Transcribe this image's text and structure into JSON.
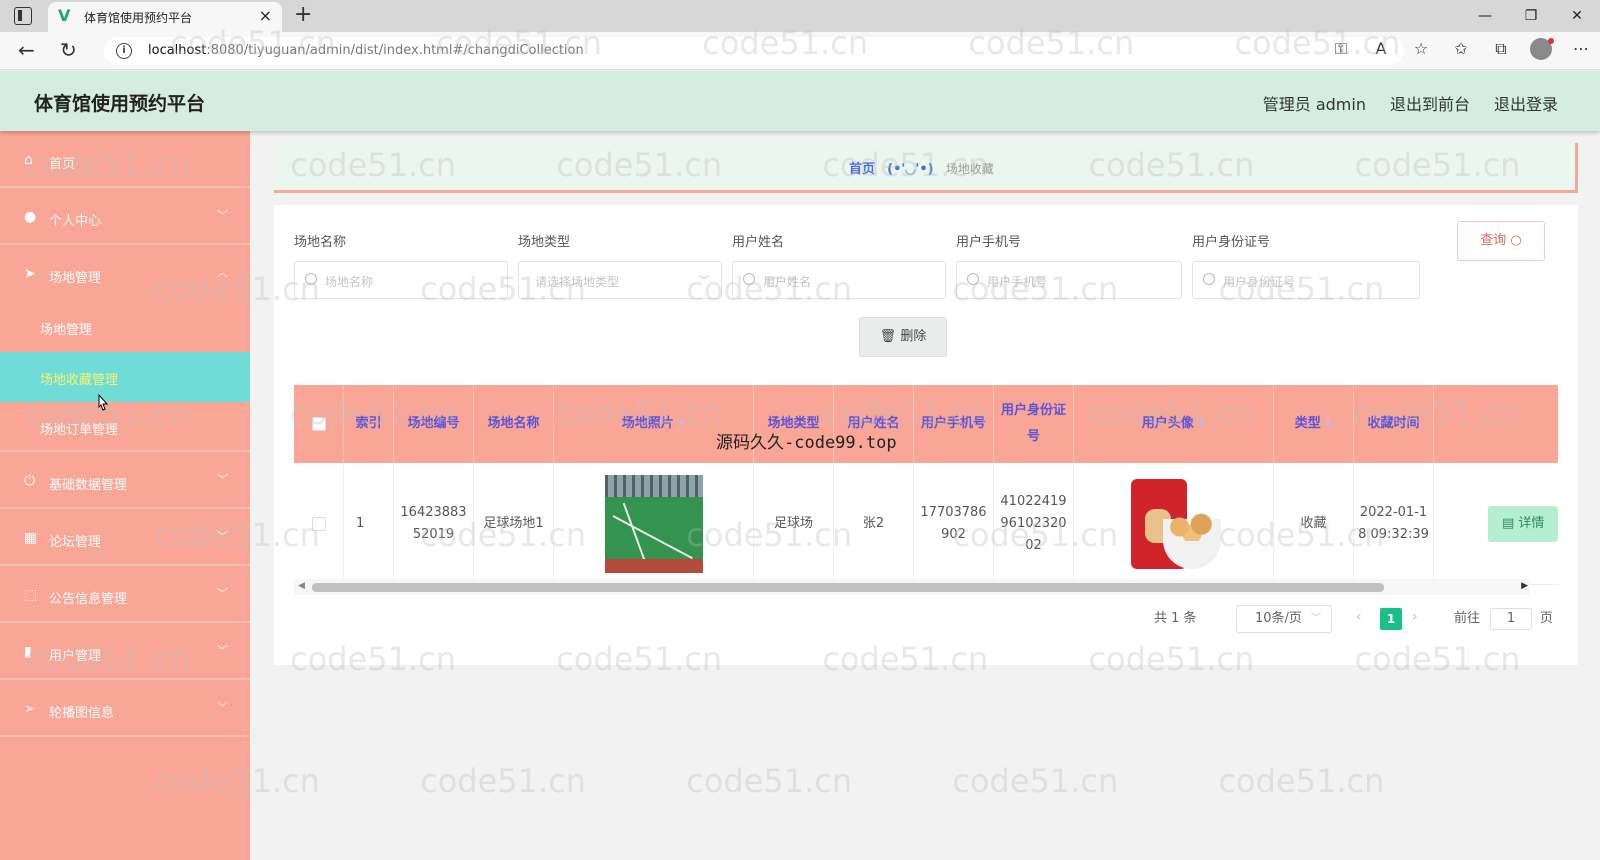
{
  "browser": {
    "tab_title": "体育馆使用预约平台",
    "url_host": "localhost",
    "url_path": ":8080/tiyuguan/admin/dist/index.html#/changdiCollection"
  },
  "header": {
    "title": "体育馆使用预约平台",
    "admin": "管理员 admin",
    "to_front": "退出到前台",
    "logout": "退出登录"
  },
  "sidebar": {
    "items": [
      {
        "label": "首页",
        "icon": "home-icon"
      },
      {
        "label": "个人中心",
        "icon": "user-icon"
      },
      {
        "label": "场地管理",
        "icon": "send-icon",
        "expanded": true,
        "children": [
          {
            "label": "场地管理"
          },
          {
            "label": "场地收藏管理",
            "active": true
          },
          {
            "label": "场地订单管理"
          }
        ]
      },
      {
        "label": "基础数据管理",
        "icon": "power-icon"
      },
      {
        "label": "论坛管理",
        "icon": "calendar-icon"
      },
      {
        "label": "公告信息管理",
        "icon": "frame-icon"
      },
      {
        "label": "用户管理",
        "icon": "bar-chart-icon"
      },
      {
        "label": "轮播图信息",
        "icon": "navigation-icon"
      }
    ]
  },
  "breadcrumb": {
    "home": "首页",
    "separator": "(•'◡'•)",
    "current": "场地收藏"
  },
  "filters": {
    "venue_name": {
      "label": "场地名称",
      "placeholder": "场地名称"
    },
    "venue_type": {
      "label": "场地类型",
      "placeholder": "请选择场地类型"
    },
    "user_name": {
      "label": "用户姓名",
      "placeholder": "用户姓名"
    },
    "user_phone": {
      "label": "用户手机号",
      "placeholder": "用户手机号"
    },
    "user_id": {
      "label": "用户身份证号",
      "placeholder": "用户身份证号"
    },
    "query_button": "查询"
  },
  "delete_button": "删除",
  "table": {
    "headers": {
      "index": "索引",
      "venue_no": "场地编号",
      "venue_name": "场地名称",
      "venue_photo": "场地照片",
      "venue_type": "场地类型",
      "user_name": "用户姓名",
      "user_phone": "用户手机号",
      "user_id": "用户身份证号",
      "user_avatar": "用户头像",
      "type": "类型",
      "collect_time": "收藏时间"
    },
    "rows": [
      {
        "index": "1",
        "venue_no": "1642388352019",
        "venue_name": "足球场地1",
        "venue_type": "足球场",
        "user_name": "张2",
        "user_phone": "17703786902",
        "user_id": "410224199610232002",
        "type": "收藏",
        "collect_time": "2022-01-18 09:32:39",
        "action": "详情"
      }
    ]
  },
  "pagination": {
    "total": "共 1 条",
    "page_size": "10条/页",
    "current_page": "1",
    "goto_label": "前往",
    "goto_value": "1",
    "page_suffix": "页"
  },
  "watermark": "code51.cn",
  "overlay_text": "源码久久-code99.top",
  "colors": {
    "sidebar_bg": "#f9a697",
    "header_bg": "#d5ede0",
    "active_item": "#6fdcd8",
    "table_header_text": "#5c55d8"
  }
}
